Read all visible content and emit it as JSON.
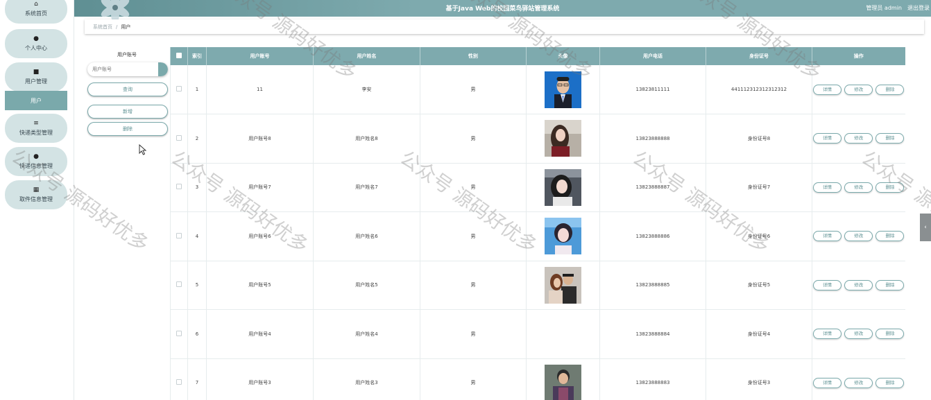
{
  "header": {
    "title": "基于Java Web的校园菜鸟驿站管理系统",
    "user": "管理员 admin",
    "logout": "退出登录"
  },
  "sidebar": {
    "items": [
      {
        "label": "系统首页",
        "icon": "home-icon"
      },
      {
        "label": "个人中心",
        "icon": "person-icon"
      },
      {
        "label": "用户管理",
        "icon": "briefcase-icon"
      },
      {
        "label": "用户",
        "icon": ""
      },
      {
        "label": "快递类型管理",
        "icon": "sliders-icon"
      },
      {
        "label": "快递信息管理",
        "icon": "pin-icon"
      },
      {
        "label": "取件信息管理",
        "icon": "grid-icon"
      }
    ]
  },
  "breadcrumb": {
    "home": "系统首页",
    "separator": "/",
    "current": "用户"
  },
  "search": {
    "label": "用户账号",
    "placeholder": "用户账号",
    "query_button": "查询",
    "add_button": "新增",
    "delete_button": "删除"
  },
  "table": {
    "headers": [
      "",
      "索引",
      "用户账号",
      "用户姓名",
      "性别",
      "头像",
      "用户电话",
      "身份证号",
      "操作"
    ],
    "rows": [
      {
        "index": "1",
        "account": "11",
        "name": "李安",
        "gender": "男",
        "avatar": "photo-blue",
        "phone": "13823811111",
        "id_no": "441112312312312312"
      },
      {
        "index": "2",
        "account": "用户账号8",
        "name": "用户姓名8",
        "gender": "男",
        "avatar": "photo-girl-1",
        "phone": "13823888888",
        "id_no": "身份证号8"
      },
      {
        "index": "3",
        "account": "用户账号7",
        "name": "用户姓名7",
        "gender": "男",
        "avatar": "photo-girl-2",
        "phone": "13823888887",
        "id_no": "身份证号7"
      },
      {
        "index": "4",
        "account": "用户账号6",
        "name": "用户姓名6",
        "gender": "男",
        "avatar": "photo-girl-3",
        "phone": "13823888886",
        "id_no": "身份证号6"
      },
      {
        "index": "5",
        "account": "用户账号5",
        "name": "用户姓名5",
        "gender": "男",
        "avatar": "photo-couple",
        "phone": "13823888885",
        "id_no": "身份证号5"
      },
      {
        "index": "6",
        "account": "用户账号4",
        "name": "用户姓名4",
        "gender": "男",
        "avatar": "",
        "phone": "13823888884",
        "id_no": "身份证号4"
      },
      {
        "index": "7",
        "account": "用户账号3",
        "name": "用户姓名3",
        "gender": "男",
        "avatar": "photo-man",
        "phone": "13823888883",
        "id_no": "身份证号3"
      }
    ],
    "actions": {
      "detail": "详情",
      "edit": "修改",
      "delete": "删除"
    }
  },
  "watermark": "公众号 源码好优多",
  "colors": {
    "accent": "#7eaaae",
    "sidebar_pill": "#d3e3e4",
    "active": "#7aa9ab"
  }
}
